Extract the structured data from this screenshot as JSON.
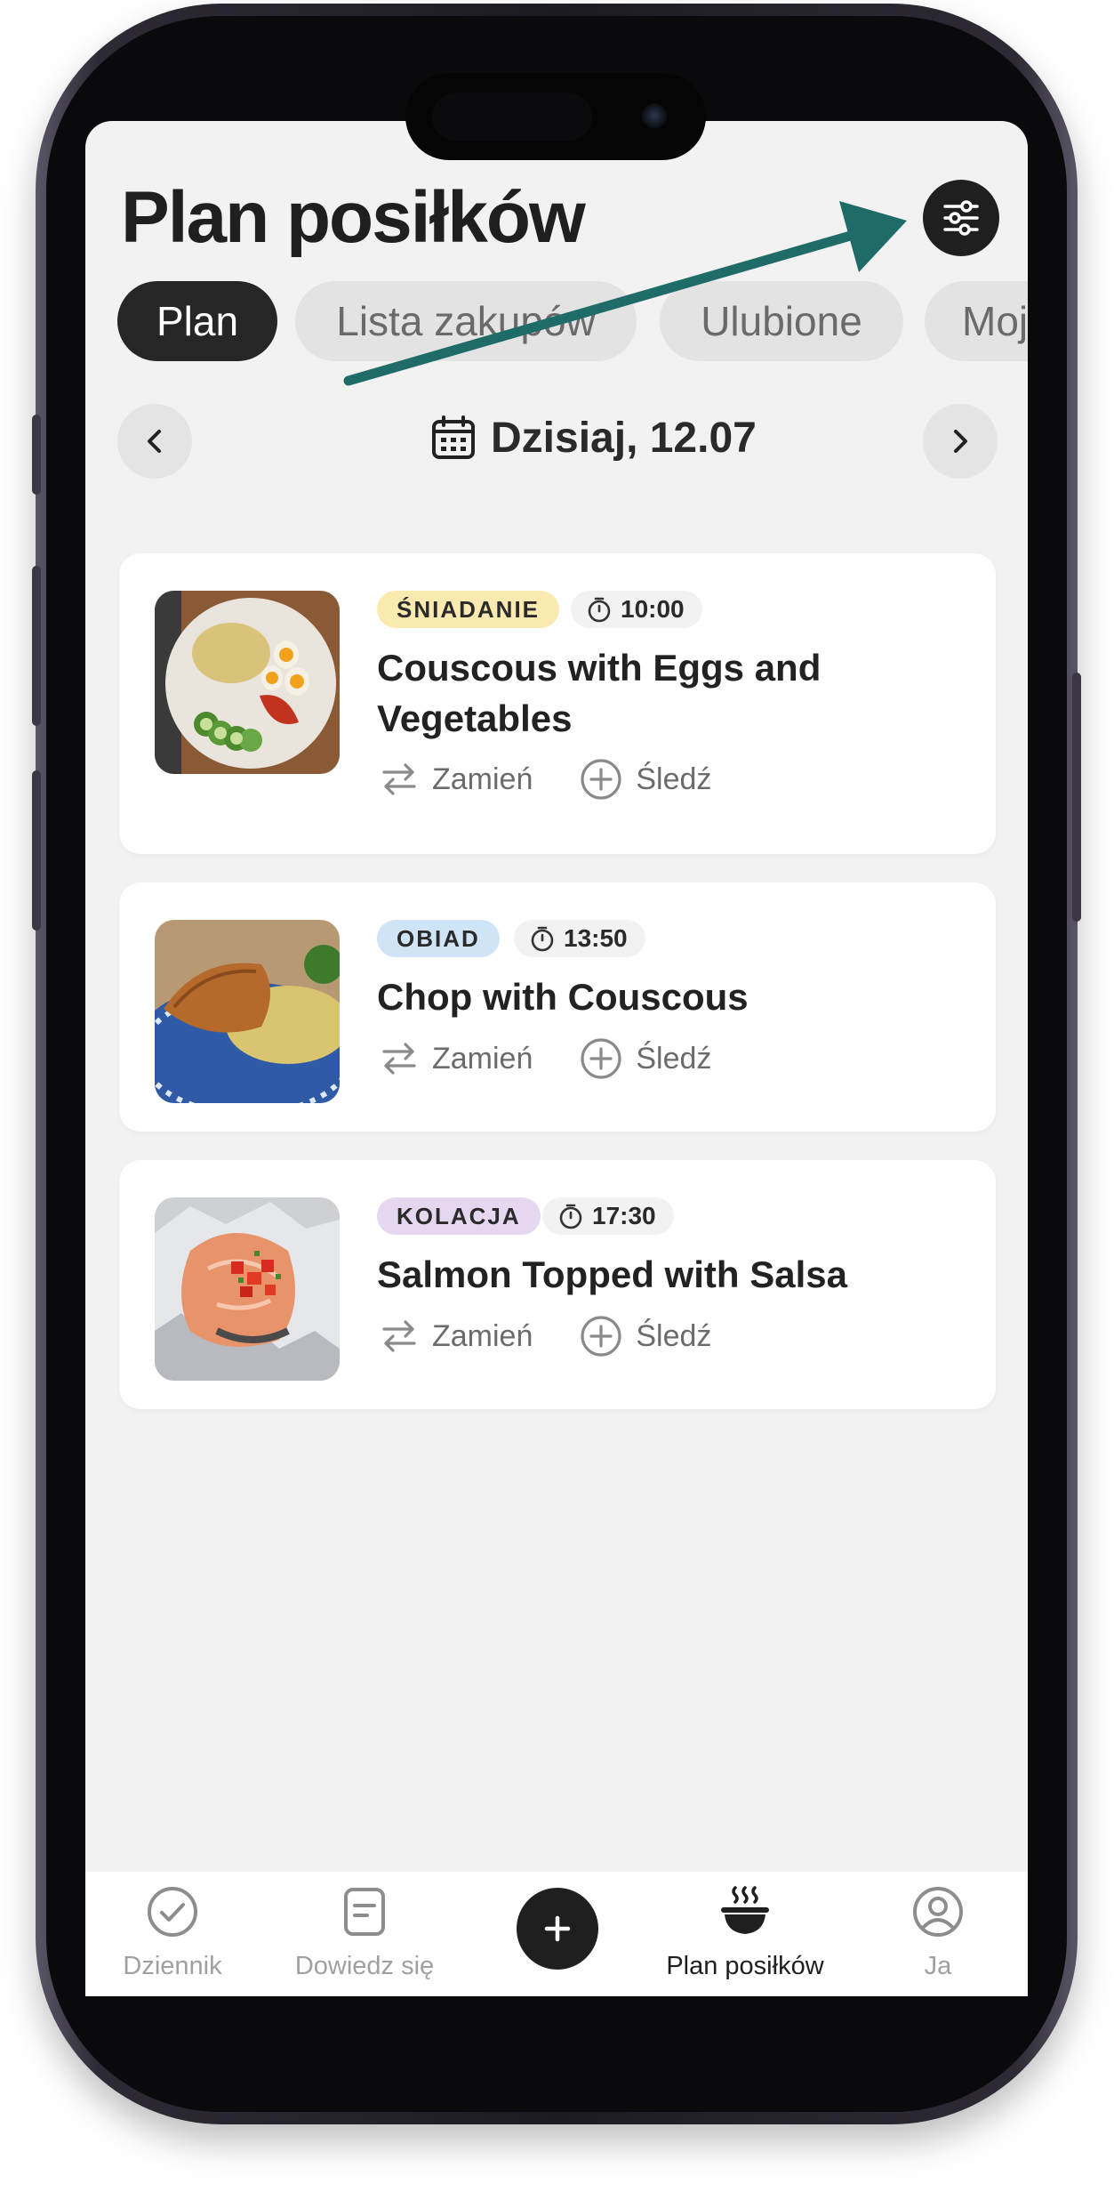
{
  "page": {
    "title": "Plan posiłków"
  },
  "tabs": [
    {
      "label": "Plan",
      "active": true
    },
    {
      "label": "Lista zakupów",
      "active": false
    },
    {
      "label": "Ulubione",
      "active": false
    },
    {
      "label": "Moje",
      "active": false
    }
  ],
  "date": {
    "label": "Dzisiaj, 12.07"
  },
  "meals": [
    {
      "type": "ŚNIADANIE",
      "type_color": "#fbeab0",
      "time": "10:00",
      "title": "Couscous with Eggs and Vegetables",
      "swap_label": "Zamień",
      "track_label": "Śledź",
      "image_icon": "couscous-eggs-photo"
    },
    {
      "type": "OBIAD",
      "type_color": "#cfe4f7",
      "time": "13:50",
      "title": "Chop with Couscous",
      "swap_label": "Zamień",
      "track_label": "Śledź",
      "image_icon": "chop-couscous-photo"
    },
    {
      "type": "KOLACJA",
      "type_color": "#e4d7ef",
      "time": "17:30",
      "title": "Salmon Topped with Salsa",
      "swap_label": "Zamień",
      "track_label": "Śledź",
      "image_icon": "salmon-salsa-photo"
    }
  ],
  "bottom_nav": [
    {
      "label": "Dziennik",
      "icon": "check-circle-icon",
      "active": false
    },
    {
      "label": "Dowiedz się",
      "icon": "note-icon",
      "active": false
    },
    {
      "label": "Plan posiłków",
      "icon": "bowl-icon",
      "active": true
    },
    {
      "label": "Ja",
      "icon": "user-circle-icon",
      "active": false
    }
  ],
  "colors": {
    "accent_dark": "#1f1f1f",
    "annotation_arrow": "#1e6b67",
    "background": "#f2f2f2"
  }
}
